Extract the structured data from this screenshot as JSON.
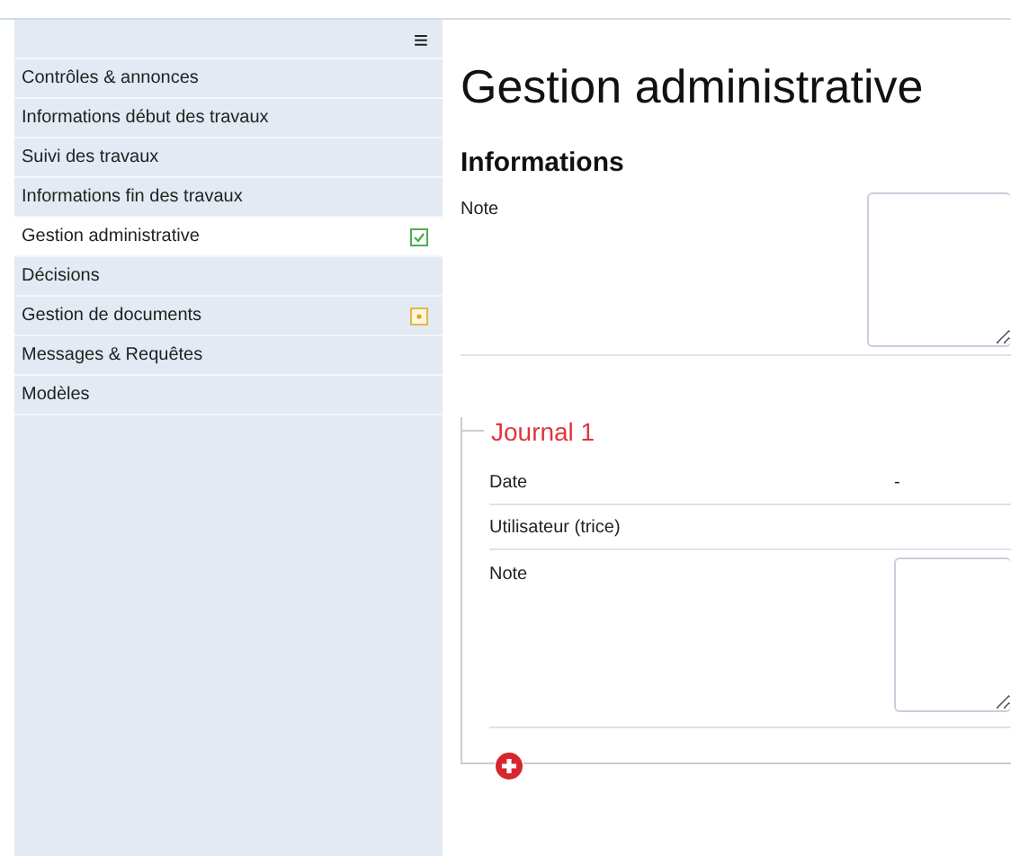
{
  "sidebar": {
    "menu_icon": "≡",
    "items": [
      {
        "label": "Contrôles & annonces",
        "selected": false,
        "kind": "plain"
      },
      {
        "label": "Informations début des travaux",
        "selected": false,
        "kind": "plain"
      },
      {
        "label": "Suivi des travaux",
        "selected": false,
        "kind": "plain"
      },
      {
        "label": "Informations fin des travaux",
        "selected": false,
        "kind": "plain"
      },
      {
        "label": "Gestion administrative",
        "selected": true,
        "kind": "done"
      },
      {
        "label": "Décisions",
        "selected": false,
        "kind": "plain"
      },
      {
        "label": "Gestion de documents",
        "selected": false,
        "kind": "pending"
      },
      {
        "label": "Messages & Requêtes",
        "selected": false,
        "kind": "plain"
      },
      {
        "label": "Modèles",
        "selected": false,
        "kind": "plain"
      }
    ]
  },
  "main": {
    "title": "Gestion administrative",
    "section": {
      "title": "Informations",
      "note_label": "Note"
    },
    "journal": {
      "title": "Journal 1",
      "date_label": "Date",
      "date_value": "-",
      "user_label": "Utilisateur (trice)",
      "note_label": "Note"
    }
  }
}
